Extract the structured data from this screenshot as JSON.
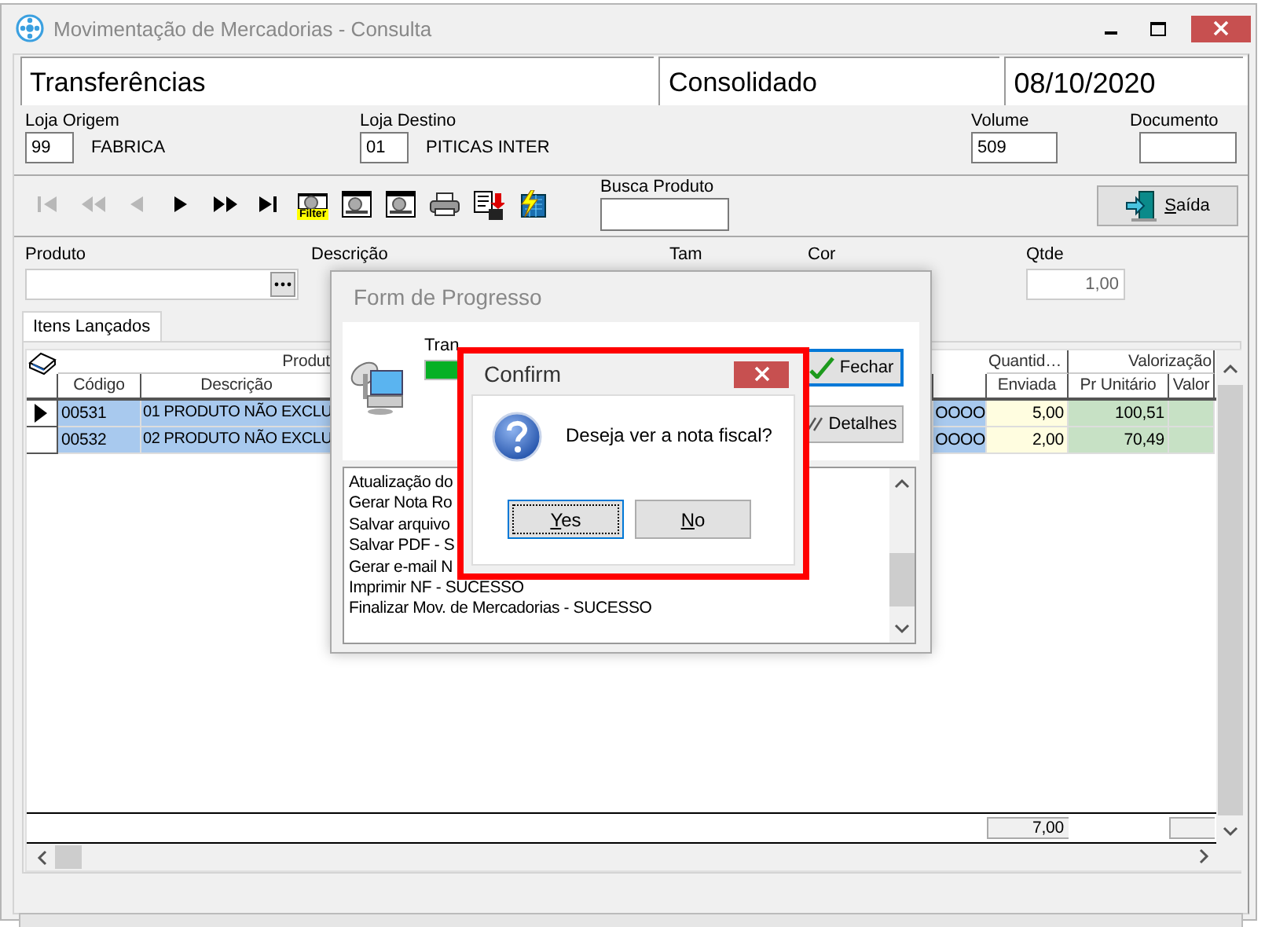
{
  "window": {
    "title": "Movimentação de Mercadorias - Consulta"
  },
  "header": {
    "operation": "Transferências",
    "mode": "Consolidado",
    "date": "08/10/2020"
  },
  "origin": {
    "label": "Loja Origem",
    "code": "99",
    "name": "FABRICA"
  },
  "destination": {
    "label": "Loja Destino",
    "code": "01",
    "name": "PITICAS INTER"
  },
  "volume": {
    "label": "Volume",
    "value": "509"
  },
  "document": {
    "label": "Documento"
  },
  "toolbar": [
    {
      "kind": "first",
      "disabled": true
    },
    {
      "kind": "prev_page",
      "disabled": true
    },
    {
      "kind": "prev",
      "disabled": true
    },
    {
      "kind": "next",
      "disabled": false
    },
    {
      "kind": "next_page",
      "disabled": false
    },
    {
      "kind": "last",
      "disabled": false
    },
    {
      "kind": "filter",
      "label": "Filter",
      "disabled": false
    },
    {
      "kind": "report",
      "disabled": false
    },
    {
      "kind": "report",
      "disabled": false
    },
    {
      "kind": "print",
      "disabled": false
    },
    {
      "kind": "export",
      "disabled": false
    },
    {
      "kind": "lightning",
      "disabled": false
    }
  ],
  "search": {
    "label": "Busca Produto"
  },
  "exit_button": {
    "label": "Saída"
  },
  "product_entry": {
    "product_label": "Produto",
    "description_label": "Descrição",
    "size_label": "Tam",
    "color_label": "Cor",
    "qty_label": "Qtde",
    "qty_value": "1,00"
  },
  "tabs": [
    {
      "label": "Itens Lançados",
      "selected": true
    }
  ],
  "grid": {
    "groups": [
      {
        "label": "Produt"
      },
      {
        "label": "Quantid…"
      },
      {
        "label": "Valorização"
      }
    ],
    "columns": [
      {
        "label": "Código",
        "kind": "text"
      },
      {
        "label": "Descrição",
        "kind": "text"
      },
      {
        "kind": "text"
      },
      {
        "label": "Enviada",
        "kind": "qty"
      },
      {
        "label": "Pr Unitário",
        "kind": "price"
      },
      {
        "label": "Valor",
        "kind": "price"
      }
    ],
    "rows": [
      {
        "current": true,
        "selected": true,
        "cells": [
          "00531",
          "01 PRODUTO NÃO EXCLU",
          "OOOO",
          "5,00",
          "100,51"
        ]
      },
      {
        "current": false,
        "selected": true,
        "cells": [
          "00532",
          "02 PRODUTO NÃO EXCLU",
          "OOOO",
          "2,00",
          "70,49"
        ]
      }
    ],
    "totals": {
      "quantity": "7,00"
    }
  },
  "progress_form": {
    "title": "Form de Progresso",
    "status_label": "Tran",
    "level": 1,
    "buttons": [
      {
        "kind": "close",
        "label": "Fechar",
        "focused": true
      },
      {
        "kind": "details",
        "label": "Detalhes",
        "focused": false
      }
    ],
    "log": [
      "Atualização do",
      "Gerar Nota Ro",
      "Salvar arquivo",
      "Salvar PDF - S",
      "Gerar e-mail N",
      "Imprimir NF - SUCESSO",
      "Finalizar Mov. de Mercadorias - SUCESSO"
    ]
  },
  "confirm": {
    "highlighted": true,
    "title": "Confirm",
    "message": "Deseja ver a nota fiscal?",
    "buttons": [
      {
        "label": "Yes",
        "focused": true
      },
      {
        "label": "No",
        "focused": false
      }
    ]
  }
}
